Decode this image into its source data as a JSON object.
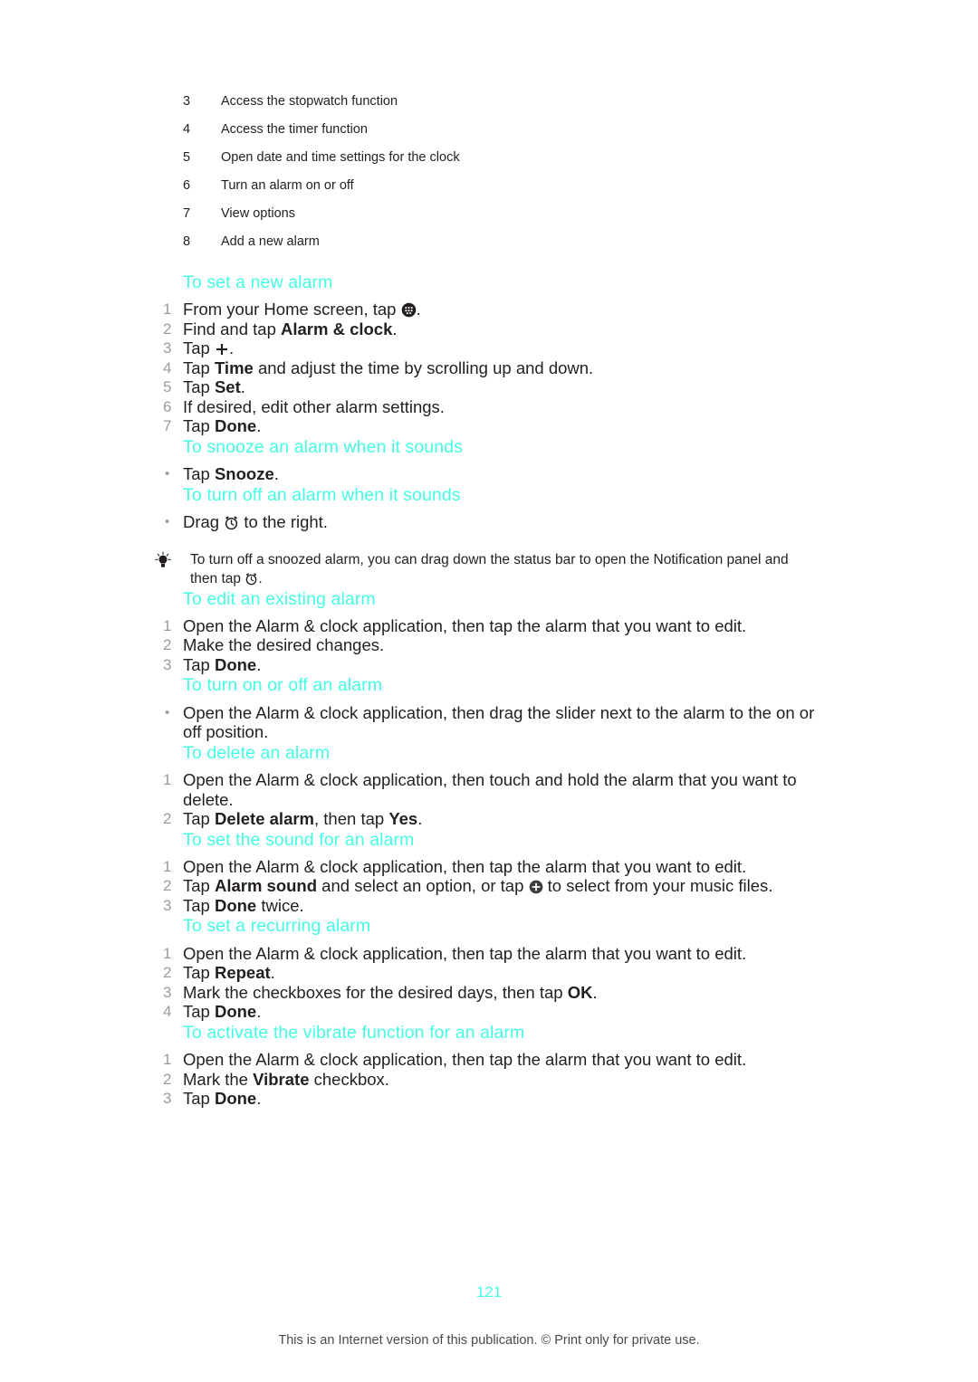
{
  "legend": {
    "rows": [
      {
        "num": "3",
        "text": "Access the stopwatch function"
      },
      {
        "num": "4",
        "text": "Access the timer function"
      },
      {
        "num": "5",
        "text": "Open date and time settings for the clock"
      },
      {
        "num": "6",
        "text": "Turn an alarm on or off"
      },
      {
        "num": "7",
        "text": "View options"
      },
      {
        "num": "8",
        "text": "Add a new alarm"
      }
    ]
  },
  "sections": {
    "set_new_alarm": {
      "heading": "To set a new alarm",
      "steps": [
        {
          "num": "1",
          "pre": "From your Home screen, tap ",
          "icon": "app-drawer-icon",
          "post": "."
        },
        {
          "num": "2",
          "pre": "Find and tap ",
          "bold": "Alarm & clock",
          "post": "."
        },
        {
          "num": "3",
          "pre": "Tap ",
          "icon": "plus-icon",
          "post": "."
        },
        {
          "num": "4",
          "pre": "Tap ",
          "bold": "Time",
          "post": " and adjust the time by scrolling up and down."
        },
        {
          "num": "5",
          "pre": "Tap ",
          "bold": "Set",
          "post": "."
        },
        {
          "num": "6",
          "pre": "If desired, edit other alarm settings.",
          "post": ""
        },
        {
          "num": "7",
          "pre": "Tap ",
          "bold": "Done",
          "post": "."
        }
      ]
    },
    "snooze_alarm": {
      "heading": "To snooze an alarm when it sounds",
      "bullet": "•",
      "steps": [
        {
          "pre": "Tap ",
          "bold": "Snooze",
          "post": "."
        }
      ]
    },
    "turn_off_when_sounds": {
      "heading": "To turn off an alarm when it sounds",
      "bullet": "•",
      "steps": [
        {
          "pre": "Drag ",
          "icon": "alarm-clock-icon",
          "post": " to the right."
        }
      ]
    },
    "tip": {
      "icon": "lightbulb-icon",
      "pre": "To turn off a snoozed alarm, you can drag down the status bar to open the Notification panel and then tap ",
      "icon_inline": "alarm-clock-icon",
      "post": "."
    },
    "edit_existing_alarm": {
      "heading": "To edit an existing alarm",
      "steps": [
        {
          "num": "1",
          "pre": "Open the Alarm & clock application, then tap the alarm that you want to edit."
        },
        {
          "num": "2",
          "pre": "Make the desired changes."
        },
        {
          "num": "3",
          "pre": "Tap ",
          "bold": "Done",
          "post": "."
        }
      ]
    },
    "turn_on_or_off": {
      "heading": "To turn on or off an alarm",
      "bullet": "•",
      "steps": [
        {
          "pre": "Open the Alarm & clock application, then drag the slider next to the alarm to the on or off position."
        }
      ]
    },
    "delete_alarm": {
      "heading": "To delete an alarm",
      "steps": [
        {
          "num": "1",
          "pre": "Open the Alarm & clock application, then touch and hold the alarm that you want to delete."
        },
        {
          "num": "2",
          "pre": "Tap ",
          "bold": "Delete alarm",
          "mid": ", then tap ",
          "bold2": "Yes",
          "post": "."
        }
      ]
    },
    "set_sound": {
      "heading": "To set the sound for an alarm",
      "steps": [
        {
          "num": "1",
          "pre": "Open the Alarm & clock application, then tap the alarm that you want to edit."
        },
        {
          "num": "2",
          "pre": "Tap ",
          "bold": "Alarm sound",
          "mid": " and select an option, or tap ",
          "icon": "circle-plus-icon",
          "post": " to select from your music files."
        },
        {
          "num": "3",
          "pre": "Tap ",
          "bold": "Done",
          "post": " twice."
        }
      ]
    },
    "recurring_alarm": {
      "heading": "To set a recurring alarm",
      "steps": [
        {
          "num": "1",
          "pre": "Open the Alarm & clock application, then tap the alarm that you want to edit."
        },
        {
          "num": "2",
          "pre": "Tap ",
          "bold": "Repeat",
          "post": "."
        },
        {
          "num": "3",
          "pre": "Mark the checkboxes for the desired days, then tap ",
          "bold": "OK",
          "post": "."
        },
        {
          "num": "4",
          "pre": "Tap ",
          "bold": "Done",
          "post": "."
        }
      ]
    },
    "vibrate_function": {
      "heading": "To activate the vibrate function for an alarm",
      "steps": [
        {
          "num": "1",
          "pre": "Open the Alarm & clock application, then tap the alarm that you want to edit."
        },
        {
          "num": "2",
          "pre": "Mark the ",
          "bold": "Vibrate",
          "post": " checkbox."
        },
        {
          "num": "3",
          "pre": "Tap ",
          "bold": "Done",
          "post": "."
        }
      ]
    }
  },
  "footer": {
    "page_number": "121",
    "note": "This is an Internet version of this publication. © Print only for private use."
  },
  "colors": {
    "heading": "#45FFE3",
    "body_text": "#231f20",
    "marker_gray": "#9b9b9b"
  }
}
